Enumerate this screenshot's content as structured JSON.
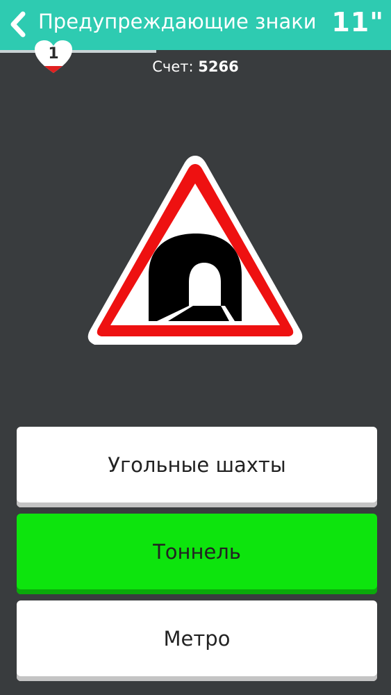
{
  "header": {
    "title": "Предупреждающие знаки",
    "timer": "11\"",
    "back_icon": "chevron-left-icon",
    "background_color": "#2ecbb1"
  },
  "progress": {
    "fraction": 0.4
  },
  "lives": {
    "count": "1",
    "icon": "heart-icon"
  },
  "score": {
    "label": "Счет:",
    "value": "5266"
  },
  "sign": {
    "icon": "tunnel-warning-sign",
    "border_color": "#ee1111"
  },
  "answers": [
    {
      "label": "Угольные шахты",
      "state": "default"
    },
    {
      "label": "Тоннель",
      "state": "correct"
    },
    {
      "label": "Метро",
      "state": "default"
    }
  ],
  "colors": {
    "background": "#393c3e",
    "correct": "#0de40d",
    "default": "#ffffff"
  }
}
